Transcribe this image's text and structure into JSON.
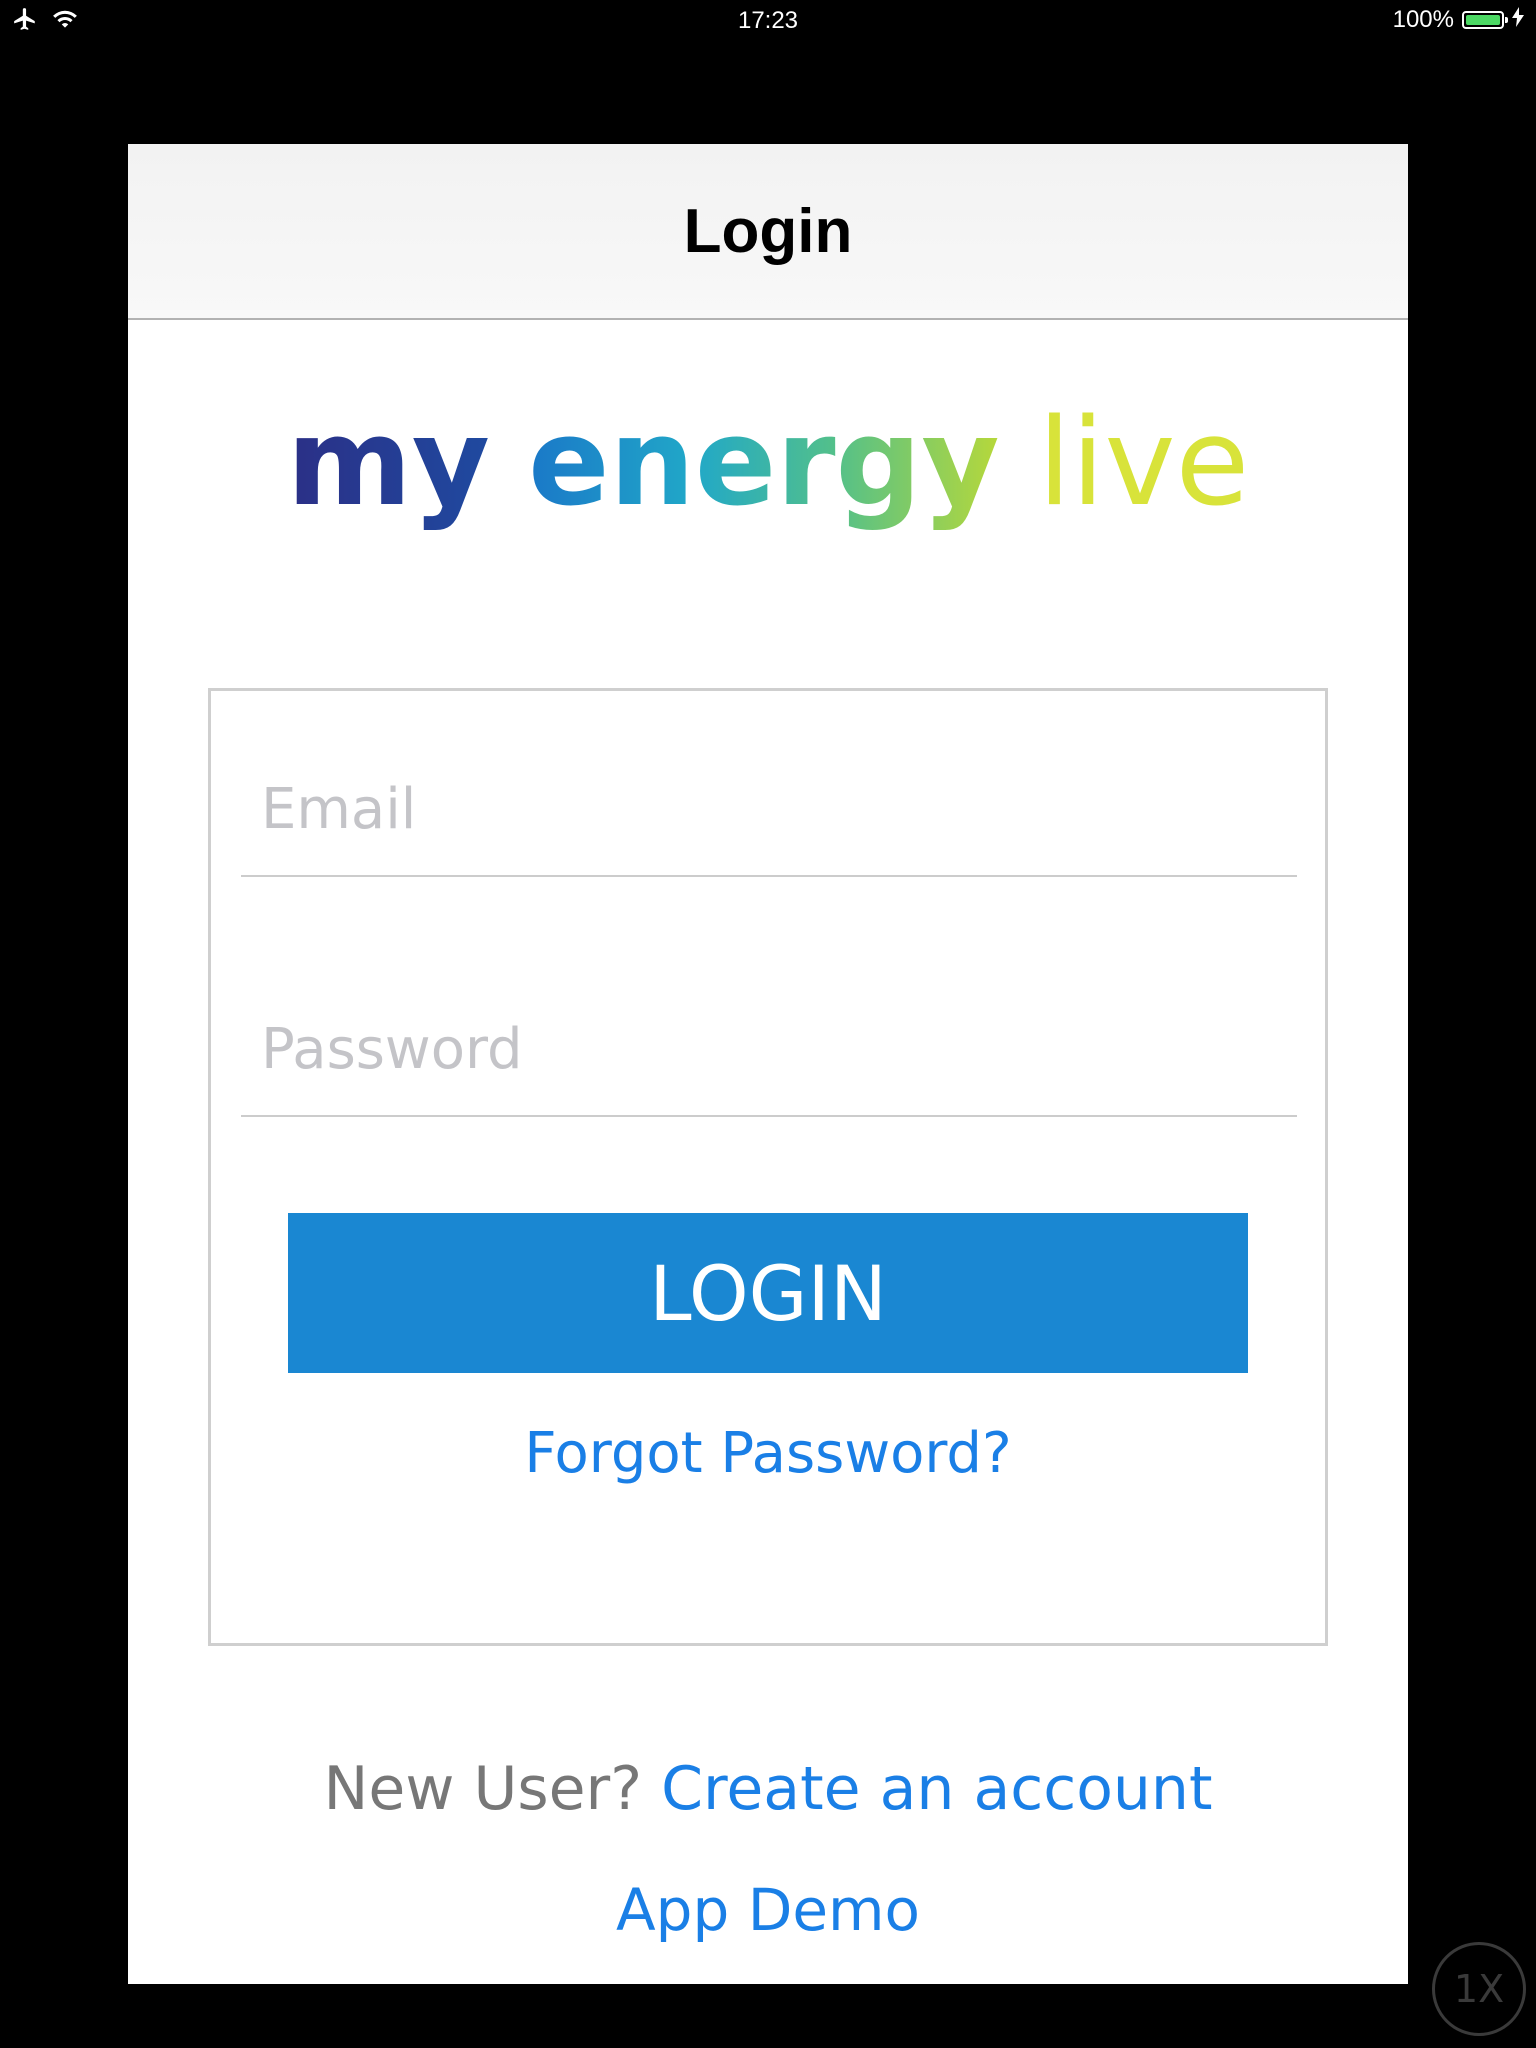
{
  "status_bar": {
    "time": "17:23",
    "battery_percent_label": "100%",
    "battery_level": 1.0,
    "icons": [
      "airplane-icon",
      "wifi-icon",
      "battery-icon",
      "charging-icon"
    ]
  },
  "nav": {
    "title": "Login"
  },
  "logo": {
    "word1": "my",
    "word2": "energy",
    "word3": "live"
  },
  "form": {
    "email": {
      "placeholder": "Email",
      "value": ""
    },
    "password": {
      "placeholder": "Password",
      "value": ""
    },
    "login_label": "LOGIN",
    "forgot_label": "Forgot Password?"
  },
  "footer": {
    "new_user_text": "New User?",
    "create_account_label": "Create an account",
    "app_demo_label": "App Demo"
  },
  "zoom_badge": "1X",
  "colors": {
    "accent": "#1a87d2",
    "link": "#1a7fe6",
    "battery": "#4cd964"
  }
}
